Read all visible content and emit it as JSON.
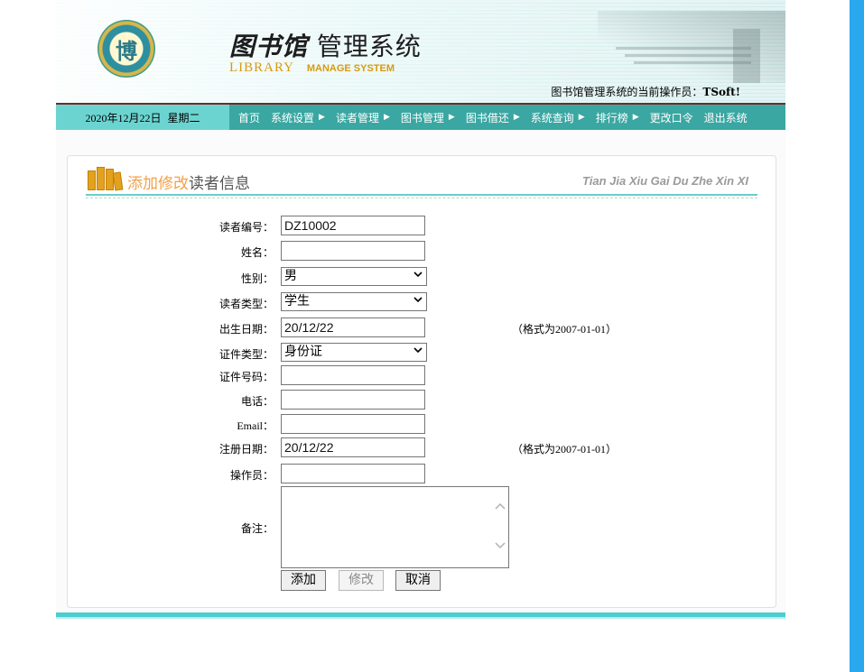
{
  "header": {
    "logo_char": "博",
    "title_lib": "图书馆",
    "title_rest": "管理系统",
    "title_en_a": "LIBRARY",
    "title_en_b": "MANAGE SYSTEM",
    "operator_prefix": "图书馆管理系统的当前操作员：",
    "operator_name": "TSoft!"
  },
  "nav": {
    "date": "2020年12月22日",
    "weekday": "星期二",
    "items": [
      {
        "label": "首页",
        "has_arrow": false
      },
      {
        "label": "系统设置",
        "has_arrow": true
      },
      {
        "label": "读者管理",
        "has_arrow": true
      },
      {
        "label": "图书管理",
        "has_arrow": true
      },
      {
        "label": "图书借还",
        "has_arrow": true
      },
      {
        "label": "系统查询",
        "has_arrow": true
      },
      {
        "label": "排行榜",
        "has_arrow": true
      },
      {
        "label": "更改口令",
        "has_arrow": false
      },
      {
        "label": "退出系统",
        "has_arrow": false
      }
    ]
  },
  "panel": {
    "title_orange": "添加修改",
    "title_dark": "读者信息",
    "pinyin": "Tian Jia Xiu Gai Du Zhe Xin XI"
  },
  "form": {
    "reader_id": {
      "label": "读者编号：",
      "value": "DZ10002"
    },
    "name": {
      "label": "姓名：",
      "value": ""
    },
    "gender": {
      "label": "性别：",
      "value": "男"
    },
    "reader_type": {
      "label": "读者类型：",
      "value": "学生"
    },
    "birth_date": {
      "label": "出生日期：",
      "value": "20/12/22",
      "hint": "（格式为2007-01-01）"
    },
    "id_type": {
      "label": "证件类型：",
      "value": "身份证"
    },
    "id_number": {
      "label": "证件号码：",
      "value": ""
    },
    "phone": {
      "label": "电话：",
      "value": ""
    },
    "email": {
      "label": "Email：",
      "value": ""
    },
    "register_date": {
      "label": "注册日期：",
      "value": "20/12/22",
      "hint": "（格式为2007-01-01）"
    },
    "operator": {
      "label": "操作员：",
      "value": ""
    },
    "remark": {
      "label": "备注：",
      "value": ""
    }
  },
  "buttons": {
    "add": "添加",
    "modify": "修改",
    "cancel": "取消"
  },
  "colors": {
    "nav_bg": "#3aa7a2",
    "date_bg": "#6cd4d0",
    "accent_orange": "#f2a04a",
    "right_strip": "#2aa8ee"
  }
}
